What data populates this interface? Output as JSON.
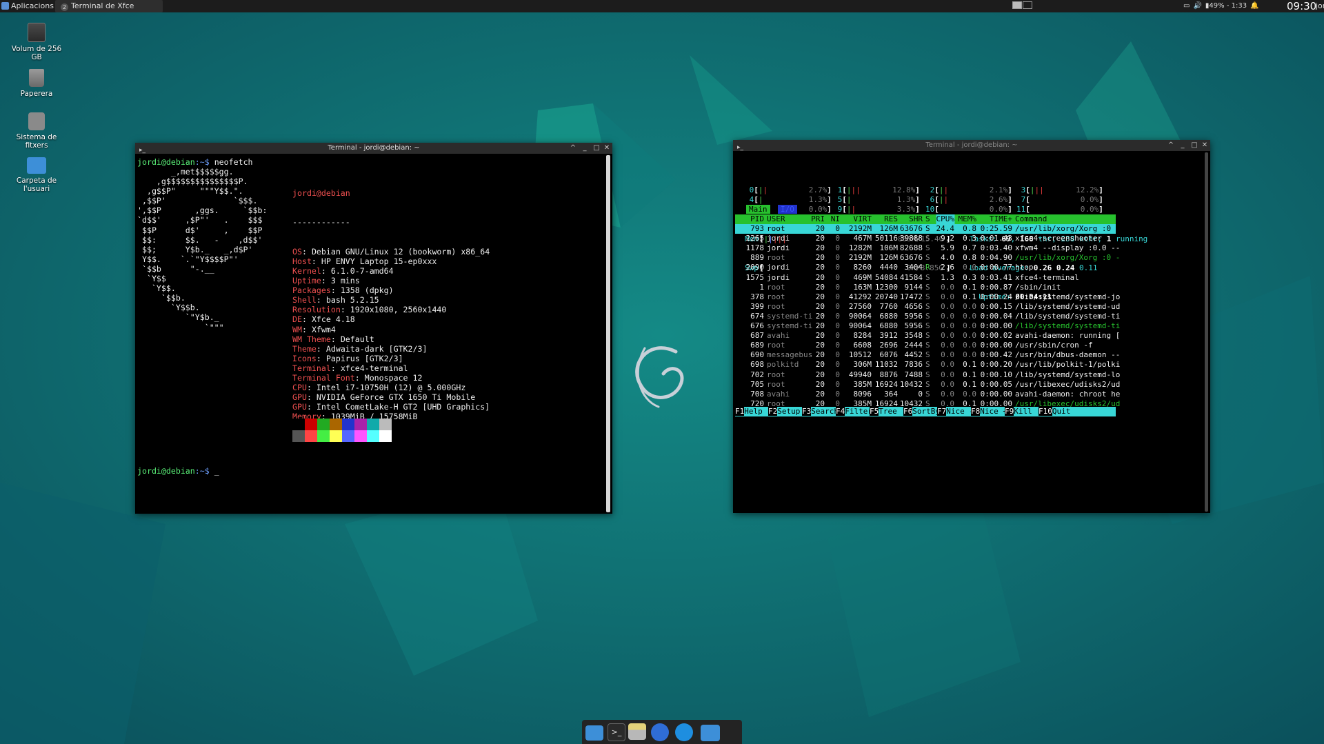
{
  "top_panel": {
    "applications_label": "Aplicacions",
    "task_label": "Terminal de Xfce",
    "task_badge": "2",
    "battery": "49% - 1:33",
    "clock": "09:30",
    "user": "jordi"
  },
  "desktop_icons": [
    {
      "label": "Volum de 256 GB",
      "icon": "drive-icon"
    },
    {
      "label": "Paperera",
      "icon": "trash-icon"
    },
    {
      "label": "Sistema de fitxers",
      "icon": "filesystem-icon"
    },
    {
      "label": "Carpeta de l'usuari",
      "icon": "home-folder-icon"
    }
  ],
  "neofetch_window": {
    "title": "Terminal - jordi@debian: ~",
    "prompt_user": "jordi@debian",
    "prompt_path": ":~$ ",
    "command": "neofetch",
    "cursor": "_",
    "logo": [
      "       _,met$$$$$gg.",
      "    ,g$$$$$$$$$$$$$$$P.",
      "  ,g$$P\"     \"\"\"Y$$.\".",
      " ,$$P'              `$$$.",
      "',$$P       ,ggs.     `$$b:",
      "`d$$'     ,$P\"'   .    $$$",
      " $$P      d$'     ,    $$P",
      " $$:      $$.   -    ,d$$'",
      " $$;      Y$b._   _,d$P'",
      " Y$$.    `.`\"Y$$$$P\"'",
      " `$$b      \"-.__",
      "  `Y$$",
      "   `Y$$.",
      "     `$$b.",
      "       `Y$$b.",
      "          `\"Y$b._",
      "              `\"\"\""
    ],
    "host_header": "jordi@debian",
    "separator": "------------",
    "info": [
      {
        "key": "OS",
        "value": "Debian GNU/Linux 12 (bookworm) x86_64"
      },
      {
        "key": "Host",
        "value": "HP ENVY Laptop 15-ep0xxx"
      },
      {
        "key": "Kernel",
        "value": "6.1.0-7-amd64"
      },
      {
        "key": "Uptime",
        "value": "3 mins"
      },
      {
        "key": "Packages",
        "value": "1358 (dpkg)"
      },
      {
        "key": "Shell",
        "value": "bash 5.2.15"
      },
      {
        "key": "Resolution",
        "value": "1920x1080, 2560x1440"
      },
      {
        "key": "DE",
        "value": "Xfce 4.18"
      },
      {
        "key": "WM",
        "value": "Xfwm4"
      },
      {
        "key": "WM Theme",
        "value": "Default"
      },
      {
        "key": "Theme",
        "value": "Adwaita-dark [GTK2/3]"
      },
      {
        "key": "Icons",
        "value": "Papirus [GTK2/3]"
      },
      {
        "key": "Terminal",
        "value": "xfce4-terminal"
      },
      {
        "key": "Terminal Font",
        "value": "Monospace 12"
      },
      {
        "key": "CPU",
        "value": "Intel i7-10750H (12) @ 5.000GHz"
      },
      {
        "key": "GPU",
        "value": "NVIDIA GeForce GTX 1650 Ti Mobile"
      },
      {
        "key": "GPU",
        "value": "Intel CometLake-H GT2 [UHD Graphics]"
      },
      {
        "key": "Memory",
        "value": "1039MiB / 15758MiB"
      }
    ],
    "palette_top": [
      "#000000",
      "#cc0000",
      "#22aa22",
      "#aa6600",
      "#2233cc",
      "#aa22aa",
      "#11aaaa",
      "#bbbbbb"
    ],
    "palette_bottom": [
      "#555555",
      "#ff4444",
      "#44ee44",
      "#ffff55",
      "#5566ff",
      "#ff55ff",
      "#55ffff",
      "#ffffff"
    ]
  },
  "htop_window": {
    "title": "Terminal - jordi@debian: ~",
    "cpus": [
      {
        "n": "0",
        "pct": "2.7%"
      },
      {
        "n": "3",
        "pct": "12.2%"
      },
      {
        "n": "6",
        "pct": "2.6%"
      },
      {
        "n": "9",
        "pct": "3.3%"
      },
      {
        "n": "1",
        "pct": "12.8%"
      },
      {
        "n": "4",
        "pct": "1.3%"
      },
      {
        "n": "7",
        "pct": "0.0%"
      },
      {
        "n": "10",
        "pct": "0.0%"
      },
      {
        "n": "2",
        "pct": "2.1%"
      },
      {
        "n": "5",
        "pct": "1.3%"
      },
      {
        "n": "8",
        "pct": "0.0%"
      },
      {
        "n": "11",
        "pct": "0.0%"
      }
    ],
    "mem_label": "Mem",
    "mem_value": "805M/15.4G",
    "swp_label": "Swp",
    "swp_value": "0K/3.85G",
    "tasks_label": "Tasks: ",
    "tasks": "69",
    "thr": "168",
    "thr_label": " thr, 238 kthr; ",
    "running": "1",
    "running_label": " running",
    "load_label": "Load average: ",
    "load1": "0.26",
    "load5": "0.24",
    "load15": "0.11",
    "uptime_label": "Uptime: ",
    "uptime": "00:04:11",
    "tab_main": "Main",
    "tab_io": "I/O",
    "columns": [
      "PID",
      "USER",
      "PRI",
      "NI",
      "VIRT",
      "RES",
      "SHR",
      "S",
      "CPU%",
      "MEM%",
      "TIME+",
      "Command"
    ],
    "processes": [
      {
        "pid": "793",
        "user": "root",
        "pri": "20",
        "ni": "0",
        "virt": "2192M",
        "res": "126M",
        "shr": "63676",
        "s": "S",
        "cpu": "24.4",
        "mem": "0.8",
        "time": "0:25.59",
        "cmd": "/usr/lib/xorg/Xorg :0 -"
      },
      {
        "pid": "2265",
        "user": "jordi",
        "pri": "20",
        "ni": "0",
        "virt": "467M",
        "res": "50116",
        "shr": "39888",
        "s": "S",
        "cpu": "9.2",
        "mem": "0.3",
        "time": "0:01.43",
        "cmd": "xfce4-screenshooter"
      },
      {
        "pid": "1178",
        "user": "jordi",
        "pri": "20",
        "ni": "0",
        "virt": "1282M",
        "res": "106M",
        "shr": "82688",
        "s": "S",
        "cpu": "5.9",
        "mem": "0.7",
        "time": "0:03.40",
        "cmd": "xfwm4 --display :0.0 --"
      },
      {
        "pid": "889",
        "user": "root",
        "pri": "20",
        "ni": "0",
        "virt": "2192M",
        "res": "126M",
        "shr": "63676",
        "s": "S",
        "cpu": "4.0",
        "mem": "0.8",
        "time": "0:04.90",
        "cmd": "/usr/lib/xorg/Xorg :0 -"
      },
      {
        "pid": "2090",
        "user": "jordi",
        "pri": "20",
        "ni": "0",
        "virt": "8260",
        "res": "4440",
        "shr": "3404",
        "s": "R",
        "cpu": "2.6",
        "mem": "0.0",
        "time": "0:00.77",
        "cmd": "htop"
      },
      {
        "pid": "1575",
        "user": "jordi",
        "pri": "20",
        "ni": "0",
        "virt": "469M",
        "res": "54084",
        "shr": "41584",
        "s": "S",
        "cpu": "1.3",
        "mem": "0.3",
        "time": "0:03.41",
        "cmd": "xfce4-terminal"
      },
      {
        "pid": "1",
        "user": "root",
        "pri": "20",
        "ni": "0",
        "virt": "163M",
        "res": "12300",
        "shr": "9144",
        "s": "S",
        "cpu": "0.0",
        "mem": "0.1",
        "time": "0:00.87",
        "cmd": "/sbin/init"
      },
      {
        "pid": "378",
        "user": "root",
        "pri": "20",
        "ni": "0",
        "virt": "41292",
        "res": "20740",
        "shr": "17472",
        "s": "S",
        "cpu": "0.0",
        "mem": "0.1",
        "time": "0:00.24",
        "cmd": "/lib/systemd/systemd-jo"
      },
      {
        "pid": "399",
        "user": "root",
        "pri": "20",
        "ni": "0",
        "virt": "27560",
        "res": "7760",
        "shr": "4656",
        "s": "S",
        "cpu": "0.0",
        "mem": "0.0",
        "time": "0:00.15",
        "cmd": "/lib/systemd/systemd-ud"
      },
      {
        "pid": "674",
        "user": "systemd-ti",
        "pri": "20",
        "ni": "0",
        "virt": "90064",
        "res": "6880",
        "shr": "5956",
        "s": "S",
        "cpu": "0.0",
        "mem": "0.0",
        "time": "0:00.04",
        "cmd": "/lib/systemd/systemd-ti"
      },
      {
        "pid": "676",
        "user": "systemd-ti",
        "pri": "20",
        "ni": "0",
        "virt": "90064",
        "res": "6880",
        "shr": "5956",
        "s": "S",
        "cpu": "0.0",
        "mem": "0.0",
        "time": "0:00.00",
        "cmd": "/lib/systemd/systemd-ti"
      },
      {
        "pid": "687",
        "user": "avahi",
        "pri": "20",
        "ni": "0",
        "virt": "8284",
        "res": "3912",
        "shr": "3548",
        "s": "S",
        "cpu": "0.0",
        "mem": "0.0",
        "time": "0:00.02",
        "cmd": "avahi-daemon: running ["
      },
      {
        "pid": "689",
        "user": "root",
        "pri": "20",
        "ni": "0",
        "virt": "6608",
        "res": "2696",
        "shr": "2444",
        "s": "S",
        "cpu": "0.0",
        "mem": "0.0",
        "time": "0:00.00",
        "cmd": "/usr/sbin/cron -f"
      },
      {
        "pid": "690",
        "user": "messagebus",
        "pri": "20",
        "ni": "0",
        "virt": "10512",
        "res": "6076",
        "shr": "4452",
        "s": "S",
        "cpu": "0.0",
        "mem": "0.0",
        "time": "0:00.42",
        "cmd": "/usr/bin/dbus-daemon --"
      },
      {
        "pid": "698",
        "user": "polkitd",
        "pri": "20",
        "ni": "0",
        "virt": "306M",
        "res": "11032",
        "shr": "7836",
        "s": "S",
        "cpu": "0.0",
        "mem": "0.1",
        "time": "0:00.20",
        "cmd": "/usr/lib/polkit-1/polki"
      },
      {
        "pid": "702",
        "user": "root",
        "pri": "20",
        "ni": "0",
        "virt": "49940",
        "res": "8876",
        "shr": "7488",
        "s": "S",
        "cpu": "0.0",
        "mem": "0.1",
        "time": "0:00.10",
        "cmd": "/lib/systemd/systemd-lo"
      },
      {
        "pid": "705",
        "user": "root",
        "pri": "20",
        "ni": "0",
        "virt": "385M",
        "res": "16924",
        "shr": "10432",
        "s": "S",
        "cpu": "0.0",
        "mem": "0.1",
        "time": "0:00.05",
        "cmd": "/usr/libexec/udisks2/ud"
      },
      {
        "pid": "708",
        "user": "avahi",
        "pri": "20",
        "ni": "0",
        "virt": "8096",
        "res": "364",
        "shr": "0",
        "s": "S",
        "cpu": "0.0",
        "mem": "0.0",
        "time": "0:00.00",
        "cmd": "avahi-daemon: chroot he"
      },
      {
        "pid": "720",
        "user": "root",
        "pri": "20",
        "ni": "0",
        "virt": "385M",
        "res": "16924",
        "shr": "10432",
        "s": "S",
        "cpu": "0.0",
        "mem": "0.1",
        "time": "0:00.00",
        "cmd": "/usr/libexec/udisks2/ud"
      }
    ],
    "function_keys": [
      {
        "key": "F1",
        "label": "Help"
      },
      {
        "key": "F2",
        "label": "Setup"
      },
      {
        "key": "F3",
        "label": "Search"
      },
      {
        "key": "F4",
        "label": "Filter"
      },
      {
        "key": "F5",
        "label": "Tree"
      },
      {
        "key": "F6",
        "label": "SortBy"
      },
      {
        "key": "F7",
        "label": "Nice -"
      },
      {
        "key": "F8",
        "label": "Nice +"
      },
      {
        "key": "F9",
        "label": "Kill"
      },
      {
        "key": "F10",
        "label": "Quit"
      }
    ]
  },
  "dock": [
    {
      "icon": "show-desktop-icon"
    },
    {
      "icon": "terminal-icon"
    },
    {
      "icon": "file-manager-icon"
    },
    {
      "icon": "web-browser-icon"
    },
    {
      "icon": "app-finder-icon"
    },
    {
      "icon": "folder-icon"
    }
  ]
}
